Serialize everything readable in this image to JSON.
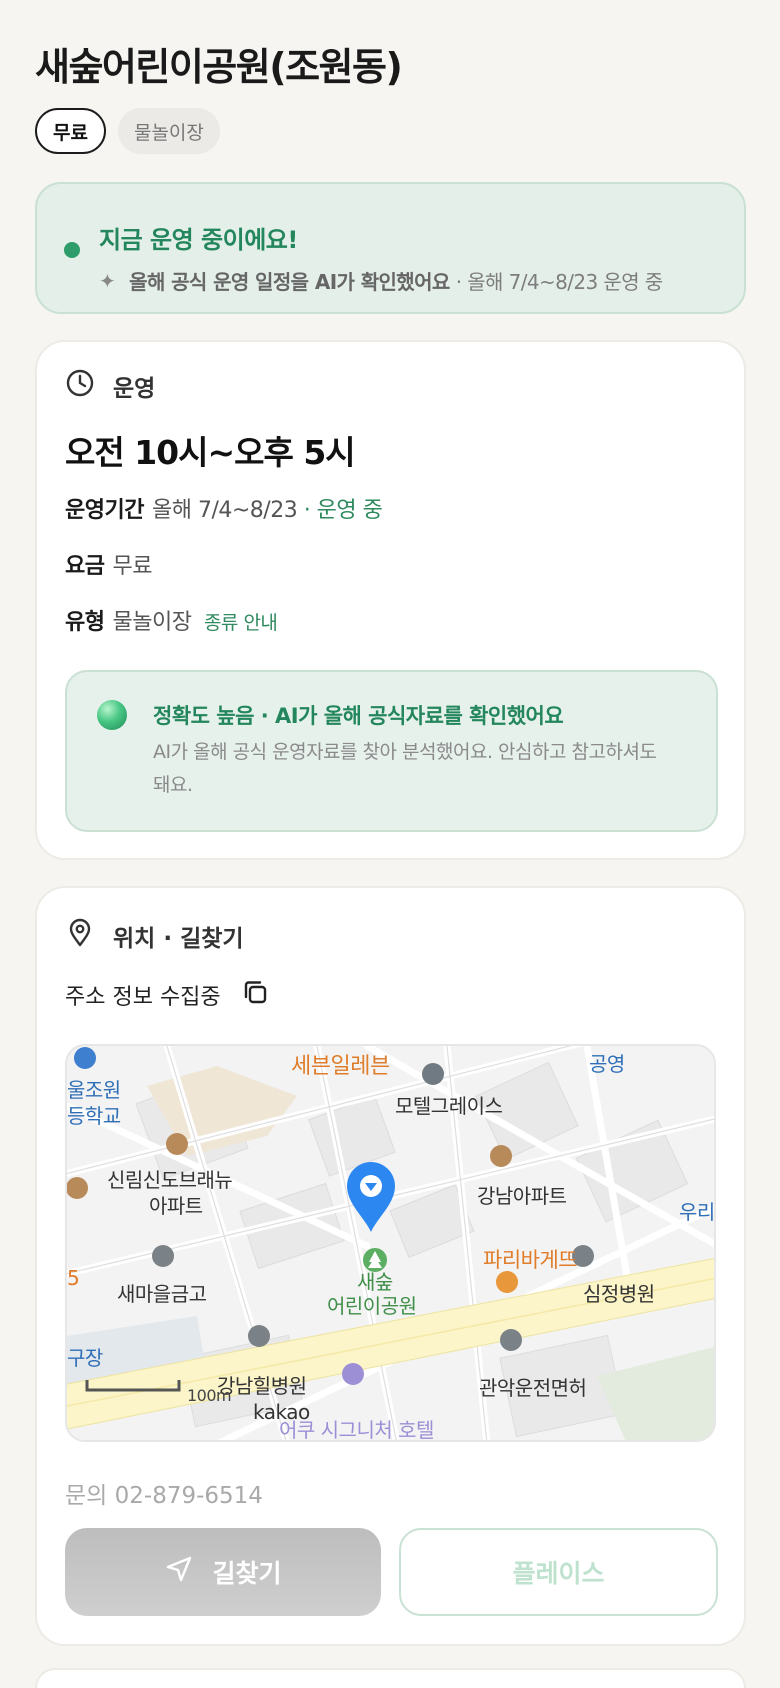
{
  "place": {
    "title": "새숲어린이공원(조원동)",
    "tags": [
      "무료",
      "물놀이장"
    ]
  },
  "status": {
    "title": "지금 운영 중이에요!",
    "verified": "올해 공식 운영 일정을 AI가 확인했어요",
    "period": "· 올해 7/4~8/23 운영 중",
    "accent_color": "#23865c"
  },
  "operation": {
    "section_label": "운영",
    "hours": "오전 10시~오후 5시",
    "period_label": "운영기간",
    "period_value": "올해 7/4~8/23",
    "period_status": "· 운영 중",
    "fee_label": "요금",
    "fee_value": "무료",
    "type_label": "유형",
    "type_value": "물놀이장",
    "type_link": "종류 안내",
    "ai": {
      "title": "정확도 높음 · AI가 올해 공식자료를 확인했어요",
      "text": "AI가 올해 공식 운영자료를 찾아 분석했어요. 안심하고 참고하셔도 돼요."
    }
  },
  "location": {
    "section_label": "위치 · 길찾기",
    "address": "주소 정보 수집중",
    "map": {
      "labels": {
        "seven_eleven": "세븐일레븐",
        "gongyeong": "공영",
        "school_1": "울조원",
        "school_2": "등학교",
        "motel": "모텔그레이스",
        "apt1_1": "신림신도브래뉴",
        "apt1_2": "아파트",
        "apt2": "강남아파트",
        "right_edge": "우리",
        "paris": "파리바게뜨",
        "bank": "새마을금고",
        "park_1": "새숲",
        "park_2": "어린이공원",
        "hospital1": "심정병원",
        "left_num": "5",
        "left_place": "구장",
        "hospital2": "강남힐병원",
        "driving": "관악운전면허",
        "hotel": "어쿠 시그니처 호텔",
        "scale": "100m",
        "logo": "kakao"
      }
    },
    "contact": "문의 02-879-6514",
    "route_button": "길찾기",
    "place_button": "플레이스"
  }
}
